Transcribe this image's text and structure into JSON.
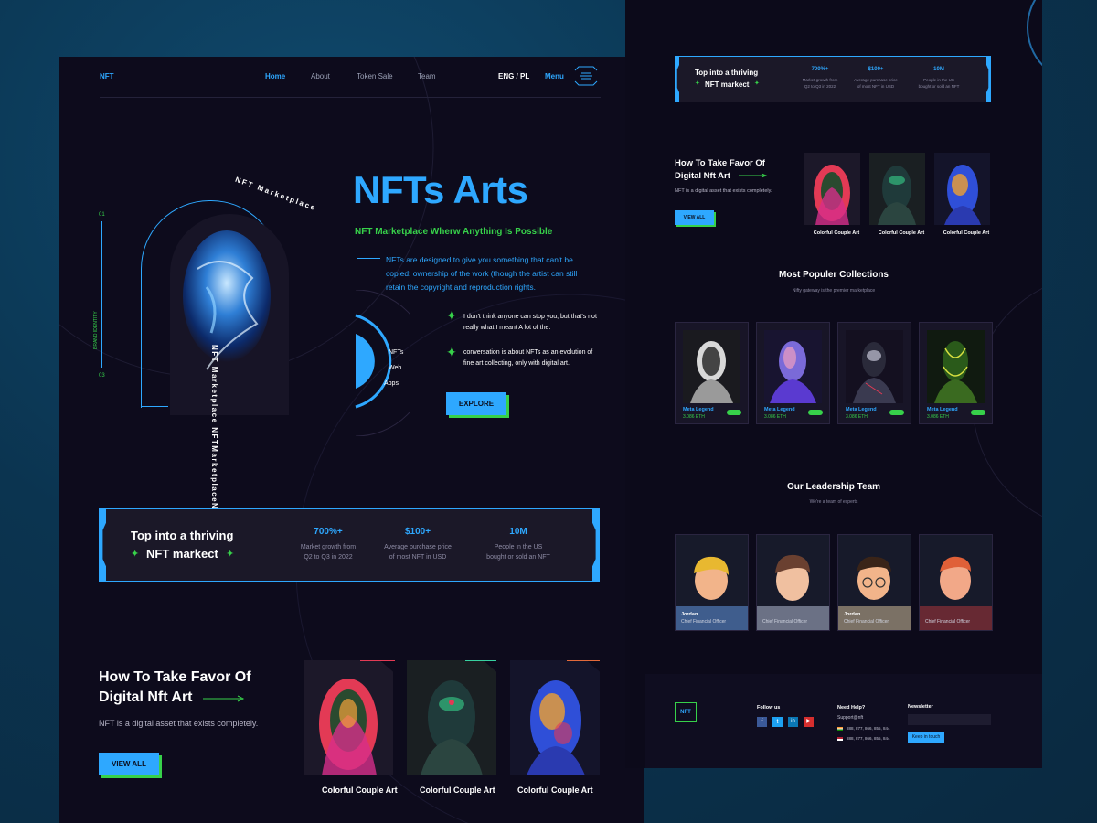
{
  "left": {
    "logo": "NFT",
    "nav": [
      "Home",
      "About",
      "Token Sale",
      "Team"
    ],
    "lang": "ENG / PL",
    "menu": "Menu",
    "hero": {
      "title": "NFTs Arts",
      "subtitle": "NFT Marketplace Wherw Anything Is Possible",
      "desc": "NFTs are designed to give you something that can't be copied: ownership of the work (though the artist can still retain the copyright and reproduction rights.",
      "bullet1": "I don't think anyone can stop you, but that's not really what I meant A lot of the.",
      "bullet2": "conversation is about NFTs as an evolution of fine art collecting, only with digital art.",
      "explore": "EXPLORE",
      "ring_text": "NFT Marketplace NFTMarketplaceNFTMa...",
      "side_top": "01",
      "side_bottom": "03",
      "side_label": "BRAND IDENTITY",
      "orbit": [
        "NFTs",
        "Web",
        "Apps"
      ]
    },
    "stats": {
      "line1": "Top into a thriving",
      "line2": "NFT markect",
      "items": [
        {
          "value": "700%+",
          "label1": "Market growth from",
          "label2": "Q2 to Q3 in 2022"
        },
        {
          "value": "$100+",
          "label1": "Average purchase price",
          "label2": "of most NFT in USD"
        },
        {
          "value": "10M",
          "label1": "People in the US",
          "label2": "bought or sold an NFT"
        }
      ]
    },
    "favor": {
      "title1": "How To Take Favor Of",
      "title2": "Digital Nft Art",
      "desc": "NFT is a digital asset that exists completely.",
      "button": "VIEW ALL",
      "captions": [
        "Colorful Couple Art",
        "Colorful Couple Art",
        "Colorful Couple Art"
      ]
    }
  },
  "right": {
    "stats": {
      "line1": "Top into a thriving",
      "line2": "NFT markect",
      "items": [
        {
          "value": "700%+",
          "label1": "Market growth from",
          "label2": "Q2 to Q3 in 2022"
        },
        {
          "value": "$100+",
          "label1": "Average purchase price",
          "label2": "of most NFT in USD"
        },
        {
          "value": "10M",
          "label1": "People in the US",
          "label2": "bought or sold an NFT"
        }
      ]
    },
    "favor": {
      "title1": "How To Take Favor Of",
      "title2": "Digital Nft Art",
      "desc": "NFT is a digital asset that exists completely.",
      "button": "VIEW ALL",
      "captions": [
        "Colorful Couple Art",
        "Colorful Couple Art",
        "Colorful Couple Art"
      ]
    },
    "collections": {
      "title": "Most Populer Collections",
      "subtitle": "Nifty gateway is the premier marketplace",
      "items": [
        {
          "name": "Meta Legend",
          "price": "3.086 ETH"
        },
        {
          "name": "Meta Legend",
          "price": "3.086 ETH"
        },
        {
          "name": "Meta Legend",
          "price": "3.086 ETH"
        },
        {
          "name": "Meta Legend",
          "price": "3.086 ETH"
        }
      ]
    },
    "team": {
      "title": "Our Leadership Team",
      "subtitle": "We're a team of experts",
      "members": [
        {
          "name": "Jordan",
          "role": "Chief Financial Officer"
        },
        {
          "name": "",
          "role": "Chief Financial Officer"
        },
        {
          "name": "Jordan",
          "role": "Chief Financial Officer"
        },
        {
          "name": "",
          "role": "Chief Financial Officer"
        }
      ]
    },
    "footer": {
      "logo": "NFT",
      "follow": "Follow us",
      "help": "Need Help?",
      "support": "Support@nft",
      "phone1": "888, 877, 866, 855, 844",
      "phone2": "888, 877, 866, 855, 844",
      "newsletter": "Newsletter",
      "keep": "Keep in touch"
    }
  },
  "colors": {
    "accent": "#2ea8ff",
    "green": "#37d14a",
    "bg": "#0d0b1c"
  }
}
